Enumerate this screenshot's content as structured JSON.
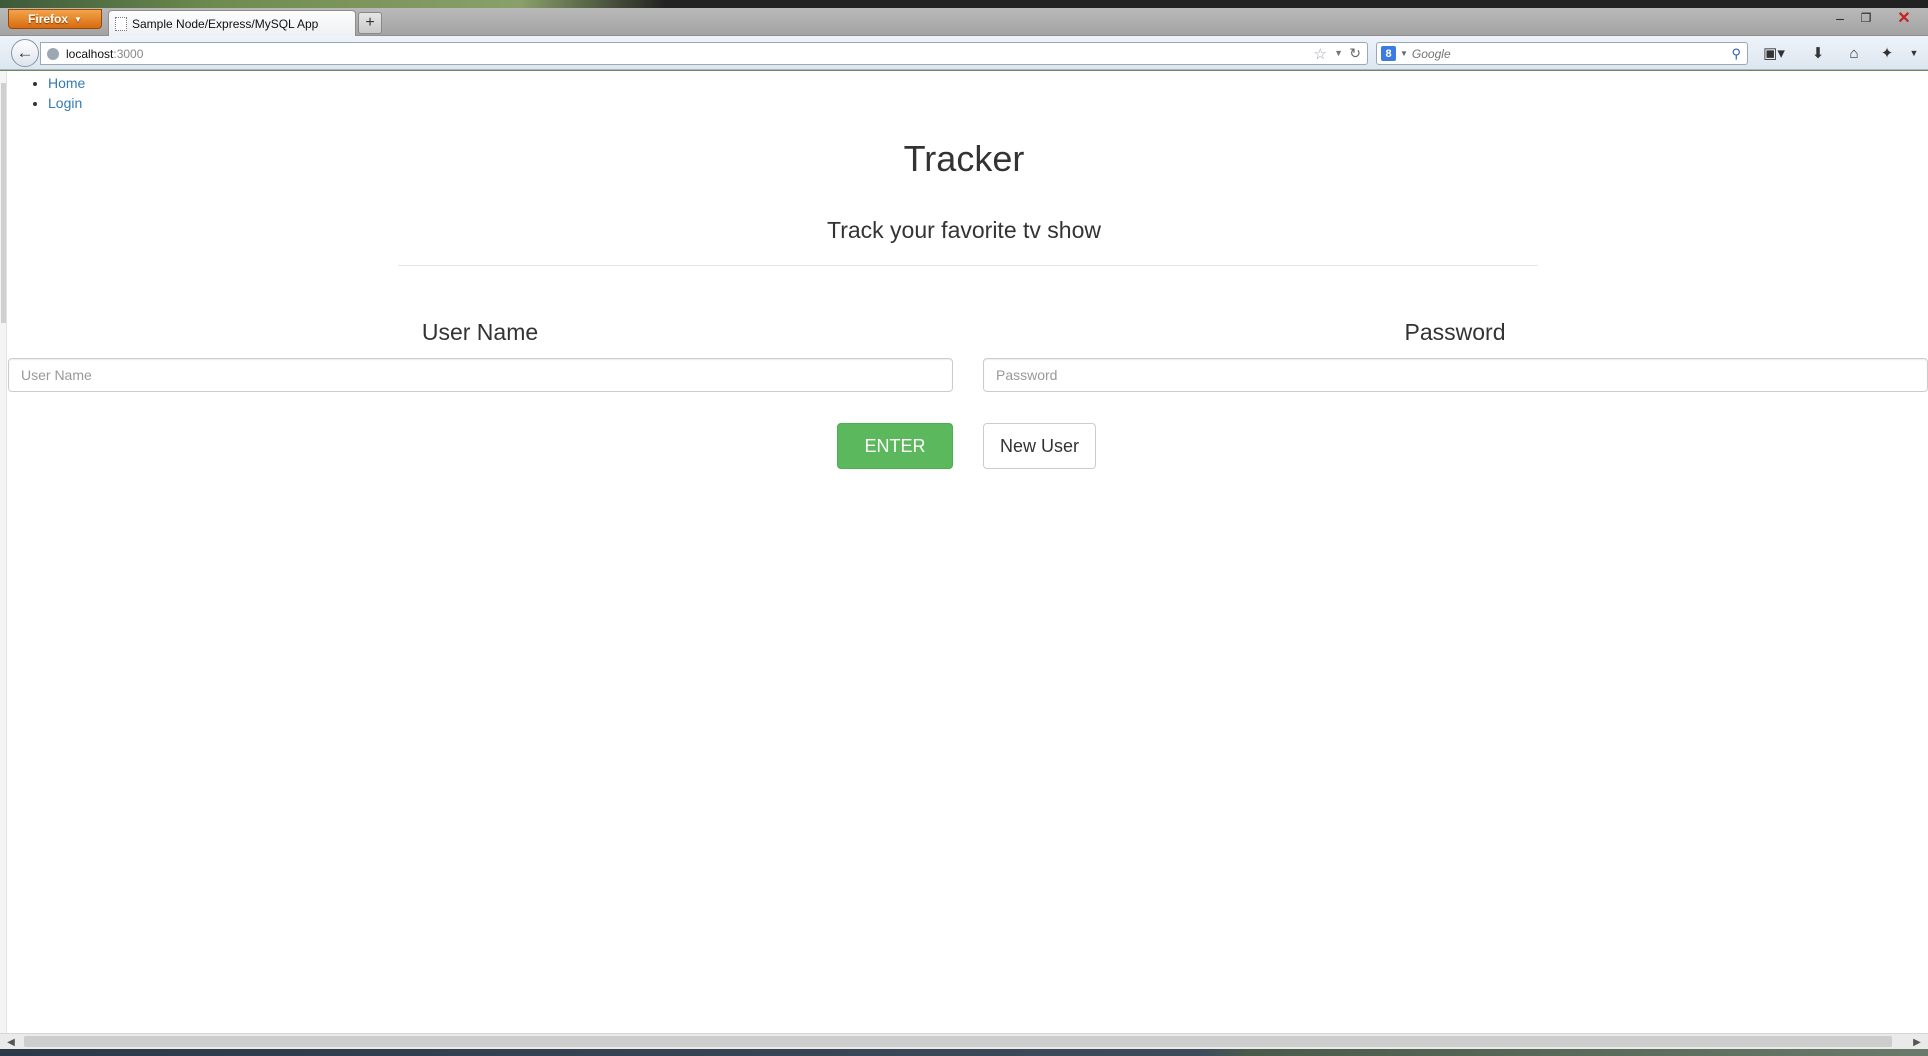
{
  "browser": {
    "menu_button": "Firefox",
    "tab_title": "Sample Node/Express/MySQL App",
    "new_tab": "+",
    "url_host": "localhost",
    "url_port": ":3000",
    "search_engine_letter": "8",
    "search_placeholder": "Google",
    "icons": {
      "back": "back-arrow-icon",
      "bookmark": "star-icon",
      "reload": "reload-icon",
      "search": "magnifier-icon",
      "downloads": "download-icon",
      "home": "home-icon"
    }
  },
  "nav": {
    "items": [
      {
        "label": "Home"
      },
      {
        "label": "Login"
      }
    ]
  },
  "page": {
    "title": "Tracker",
    "subtitle": "Track your favorite tv show"
  },
  "form": {
    "username_label": "User Name",
    "username_placeholder": "User Name",
    "password_label": "Password",
    "password_placeholder": "Password",
    "enter_label": "ENTER",
    "new_user_label": "New User"
  },
  "colors": {
    "link": "#337ab7",
    "success": "#5cb85c",
    "firefox_orange": "#e0801f"
  }
}
